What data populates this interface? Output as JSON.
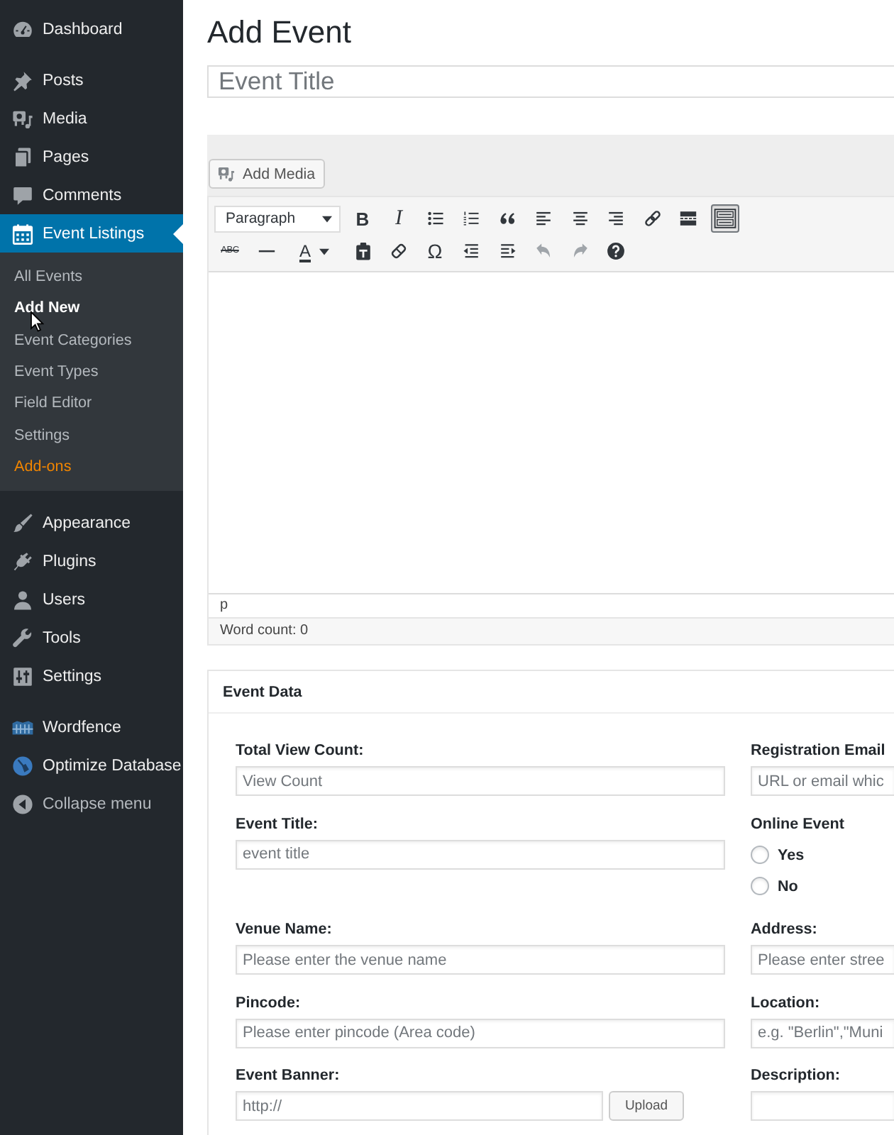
{
  "admin_menu": {
    "groups": [
      [
        {
          "label": "Dashboard",
          "kind": "dashboard",
          "selected": false
        }
      ],
      [
        {
          "label": "Posts",
          "kind": "posts",
          "selected": false
        },
        {
          "label": "Media",
          "kind": "media",
          "selected": false
        },
        {
          "label": "Pages",
          "kind": "pages",
          "selected": false
        },
        {
          "label": "Comments",
          "kind": "comments",
          "selected": false
        },
        {
          "label": "Event Listings",
          "kind": "calendar",
          "selected": true,
          "submenu": [
            {
              "label": "All Events",
              "selected": false,
              "highlight": false
            },
            {
              "label": "Add New",
              "selected": true,
              "highlight": false
            },
            {
              "label": "Event Categories",
              "selected": false,
              "highlight": false
            },
            {
              "label": "Event Types",
              "selected": false,
              "highlight": false
            },
            {
              "label": "Field Editor",
              "selected": false,
              "highlight": false
            },
            {
              "label": "Settings",
              "selected": false,
              "highlight": false
            },
            {
              "label": "Add-ons",
              "selected": false,
              "highlight": true
            }
          ]
        }
      ],
      [
        {
          "label": "Appearance",
          "kind": "appearance",
          "selected": false
        },
        {
          "label": "Plugins",
          "kind": "plugins",
          "selected": false
        },
        {
          "label": "Users",
          "kind": "users",
          "selected": false
        },
        {
          "label": "Tools",
          "kind": "tools",
          "selected": false
        },
        {
          "label": "Settings",
          "kind": "settings",
          "selected": false
        }
      ],
      [
        {
          "label": "Wordfence",
          "kind": "wordfence",
          "selected": false
        },
        {
          "label": "Optimize Database",
          "kind": "database",
          "selected": false
        }
      ]
    ],
    "collapse": {
      "label": "Collapse menu"
    }
  },
  "page_title": "Add Event",
  "title_field": {
    "placeholder": "Event Title"
  },
  "editor": {
    "add_media_button": "Add Media",
    "format_select": {
      "value": "Paragraph"
    },
    "toolbar": [
      [
        {
          "kind": "bold",
          "glyph": "B",
          "pressed": false,
          "disabled": false
        },
        {
          "kind": "italic",
          "glyph": "I",
          "pressed": false,
          "disabled": false
        },
        {
          "kind": "bullets",
          "pressed": false,
          "disabled": false
        },
        {
          "kind": "numbers",
          "pressed": false,
          "disabled": false
        },
        {
          "kind": "quote",
          "pressed": false,
          "disabled": false
        },
        {
          "kind": "alignleft",
          "pressed": false,
          "disabled": false
        },
        {
          "kind": "aligncenter",
          "pressed": false,
          "disabled": false
        },
        {
          "kind": "alignright",
          "pressed": false,
          "disabled": false
        },
        {
          "kind": "link",
          "pressed": false,
          "disabled": false
        },
        {
          "kind": "readmore",
          "pressed": false,
          "disabled": false
        },
        {
          "kind": "toggle",
          "pressed": true,
          "disabled": false
        }
      ],
      [
        {
          "kind": "strike",
          "glyph": "ABC",
          "pressed": false,
          "disabled": false
        },
        {
          "kind": "rule",
          "pressed": false,
          "disabled": false
        },
        {
          "kind": "textcolor",
          "glyph": "A",
          "pressed": false,
          "disabled": false
        },
        {
          "kind": "pastetext",
          "pressed": false,
          "disabled": false
        },
        {
          "kind": "eraser",
          "pressed": false,
          "disabled": false
        },
        {
          "kind": "symbol",
          "glyph": "Ω",
          "pressed": false,
          "disabled": false
        },
        {
          "kind": "outdent",
          "pressed": false,
          "disabled": false
        },
        {
          "kind": "indent",
          "pressed": false,
          "disabled": false
        },
        {
          "kind": "undo",
          "pressed": false,
          "disabled": true
        },
        {
          "kind": "redo",
          "pressed": false,
          "disabled": true
        },
        {
          "kind": "help",
          "pressed": false,
          "disabled": false
        }
      ]
    ],
    "path": "p",
    "word_count": "Word count: 0"
  },
  "event_data": {
    "title": "Event Data",
    "left_column": [
      {
        "kind": "text",
        "label": "Total View Count:",
        "placeholder": "View Count"
      },
      {
        "kind": "text",
        "label": "Event Title:",
        "placeholder": "event title"
      },
      {
        "kind": "text",
        "label": "Venue Name:",
        "placeholder": "Please enter the venue name"
      },
      {
        "kind": "text",
        "label": "Pincode:",
        "placeholder": "Please enter pincode (Area code)"
      },
      {
        "kind": "upload",
        "label": "Event Banner:",
        "placeholder": "http://",
        "button": "Upload"
      }
    ],
    "right_column": [
      {
        "kind": "text",
        "label": "Registration Email",
        "placeholder": "URL or email whic"
      },
      {
        "kind": "radio",
        "label": "Online Event",
        "options": [
          {
            "label": "Yes",
            "selected": false
          },
          {
            "label": "No",
            "selected": false
          }
        ]
      },
      {
        "kind": "text",
        "label": "Address:",
        "placeholder": "Please enter stree"
      },
      {
        "kind": "text",
        "label": "Location:",
        "placeholder": "e.g. \"Berlin\",\"Muni"
      },
      {
        "kind": "textarea",
        "label": "Description:"
      }
    ]
  }
}
